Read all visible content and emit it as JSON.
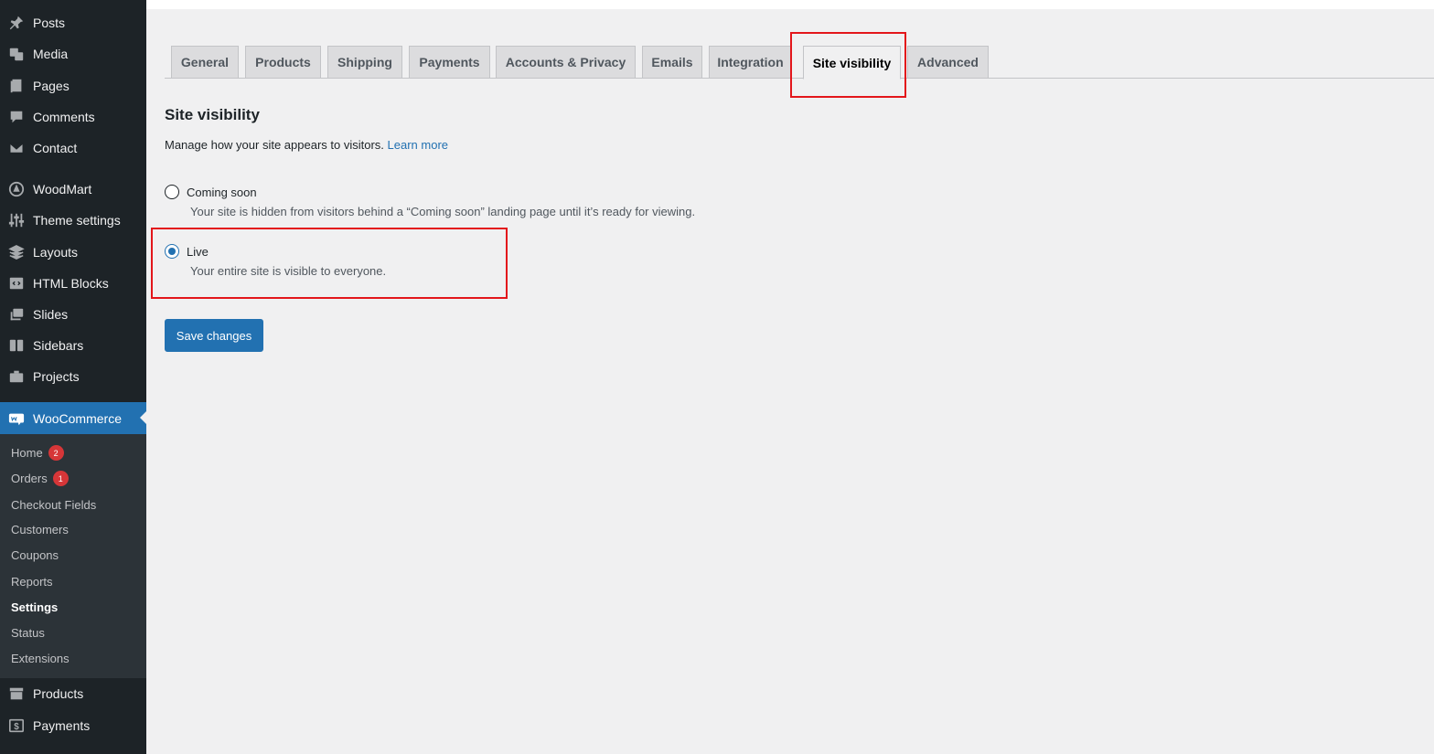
{
  "sidebar": {
    "top_items": [
      {
        "label": "Posts",
        "icon": "pushpin-icon"
      },
      {
        "label": "Media",
        "icon": "media-icon"
      },
      {
        "label": "Pages",
        "icon": "pages-icon"
      },
      {
        "label": "Comments",
        "icon": "comment-icon"
      },
      {
        "label": "Contact",
        "icon": "mail-icon"
      },
      {
        "label": "WoodMart",
        "icon": "woodmart-icon"
      },
      {
        "label": "Theme settings",
        "icon": "sliders-icon"
      },
      {
        "label": "Layouts",
        "icon": "layers-icon"
      },
      {
        "label": "HTML Blocks",
        "icon": "code-block-icon"
      },
      {
        "label": "Slides",
        "icon": "slides-icon"
      },
      {
        "label": "Sidebars",
        "icon": "sidebar-icon"
      },
      {
        "label": "Projects",
        "icon": "briefcase-icon"
      }
    ],
    "woocommerce": {
      "label": "WooCommerce",
      "icon": "woo-icon"
    },
    "submenu": [
      {
        "label": "Home",
        "badge": "2"
      },
      {
        "label": "Orders",
        "badge": "1"
      },
      {
        "label": "Checkout Fields"
      },
      {
        "label": "Customers"
      },
      {
        "label": "Coupons"
      },
      {
        "label": "Reports"
      },
      {
        "label": "Settings",
        "current": true
      },
      {
        "label": "Status"
      },
      {
        "label": "Extensions"
      }
    ],
    "bottom_items": [
      {
        "label": "Products",
        "icon": "archive-icon"
      },
      {
        "label": "Payments",
        "icon": "dollar-icon"
      }
    ]
  },
  "tabs": [
    "General",
    "Products",
    "Shipping",
    "Payments",
    "Accounts & Privacy",
    "Emails",
    "Integration",
    "Site visibility",
    "Advanced"
  ],
  "active_tab": "Site visibility",
  "content": {
    "title": "Site visibility",
    "description": "Manage how your site appears to visitors.",
    "learn_more": "Learn more",
    "options": [
      {
        "label": "Coming soon",
        "description": "Your site is hidden from visitors behind a “Coming soon” landing page until it’s ready for viewing.",
        "checked": false
      },
      {
        "label": "Live",
        "description": "Your entire site is visible to everyone.",
        "checked": true
      }
    ],
    "save_label": "Save changes"
  },
  "colors": {
    "sidebar_bg": "#1d2327",
    "accent": "#2271b1",
    "highlight": "#e3161b",
    "badge": "#d63638"
  }
}
